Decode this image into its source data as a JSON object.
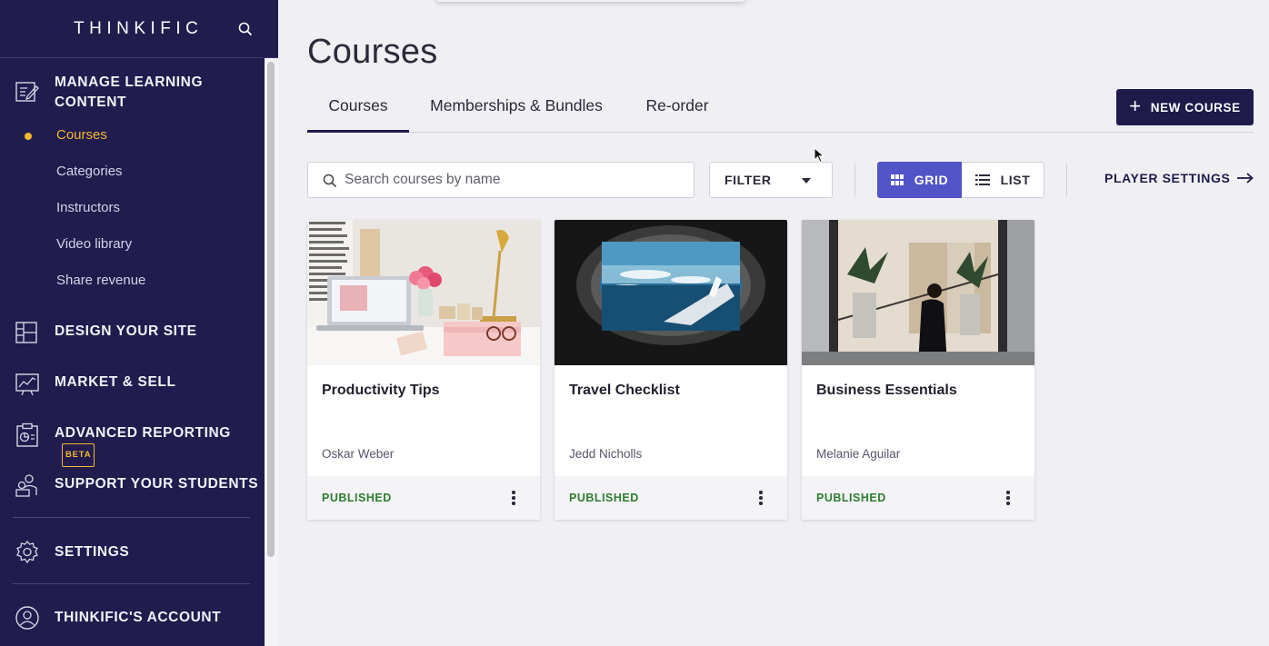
{
  "sidebar": {
    "logo": "THINKIFIC",
    "sections": [
      {
        "label": "MANAGE LEARNING CONTENT",
        "icon": "edit-content-icon"
      },
      {
        "label": "DESIGN YOUR SITE",
        "icon": "layout-icon"
      },
      {
        "label": "MARKET & SELL",
        "icon": "chart-board-icon"
      },
      {
        "label": "ADVANCED REPORTING",
        "icon": "report-clipboard-icon",
        "badge": "BETA"
      },
      {
        "label": "SUPPORT YOUR STUDENTS",
        "icon": "students-icon"
      },
      {
        "label": "SETTINGS",
        "icon": "gear-icon"
      },
      {
        "label": "THINKIFIC'S ACCOUNT",
        "icon": "user-circle-icon"
      }
    ],
    "sub_items": [
      "Courses",
      "Categories",
      "Instructors",
      "Video library",
      "Share revenue"
    ],
    "active_sub": "Courses"
  },
  "main": {
    "title": "Courses",
    "tabs": [
      "Courses",
      "Memberships & Bundles",
      "Re-order"
    ],
    "active_tab": "Courses",
    "new_course_label": "NEW COURSE",
    "search_placeholder": "Search courses by name",
    "filter_label": "FILTER",
    "view_grid_label": "GRID",
    "view_list_label": "LIST",
    "active_view": "GRID",
    "player_settings_label": "PLAYER SETTINGS"
  },
  "courses": [
    {
      "title": "Productivity Tips",
      "author": "Oskar Weber",
      "status": "PUBLISHED"
    },
    {
      "title": "Travel Checklist",
      "author": "Jedd Nicholls",
      "status": "PUBLISHED"
    },
    {
      "title": "Business Essentials",
      "author": "Melanie Aguilar",
      "status": "PUBLISHED"
    }
  ],
  "colors": {
    "sidebar_bg": "#201c4e",
    "accent_yellow": "#f5b731",
    "primary_navy": "#1e1b4b",
    "grid_active": "#5154c6",
    "published_green": "#2e7d32"
  }
}
